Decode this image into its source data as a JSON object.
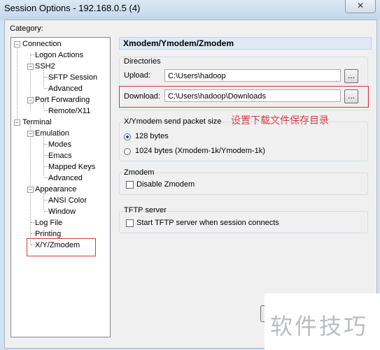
{
  "window": {
    "title": "Session Options - 192.168.0.5 (4)",
    "close_glyph": "✕"
  },
  "category": {
    "label": "Category:",
    "tree": [
      {
        "label": "Connection"
      },
      {
        "label": "Logon Actions"
      },
      {
        "label": "SSH2"
      },
      {
        "label": "SFTP Session"
      },
      {
        "label": "Advanced"
      },
      {
        "label": "Port Forwarding"
      },
      {
        "label": "Remote/X11"
      },
      {
        "label": "Terminal"
      },
      {
        "label": "Emulation"
      },
      {
        "label": "Modes"
      },
      {
        "label": "Emacs"
      },
      {
        "label": "Mapped Keys"
      },
      {
        "label": "Advanced"
      },
      {
        "label": "Appearance"
      },
      {
        "label": "ANSI Color"
      },
      {
        "label": "Window"
      },
      {
        "label": "Log File"
      },
      {
        "label": "Printing"
      },
      {
        "label": "X/Y/Zmodem"
      }
    ],
    "selected": "X/Y/Zmodem"
  },
  "panel": {
    "title": "Xmodem/Ymodem/Zmodem",
    "directories": {
      "label": "Directories",
      "upload_label": "Upload:",
      "upload_value": "C:\\Users\\hadoop",
      "download_label": "Download:",
      "download_value": "C:\\Users\\hadoop\\Downloads",
      "browse_label": "..."
    },
    "annotation": "设置下载文件保存目录",
    "packet": {
      "label": "X/Ymodem send packet size",
      "option1": "128 bytes",
      "option2": "1024 bytes  (Xmodem-1k/Ymodem-1k)",
      "selected": "128 bytes"
    },
    "zmodem": {
      "label": "Zmodem",
      "disable_label": "Disable Zmodem",
      "disable_checked": false
    },
    "tftp": {
      "label": "TFTP server",
      "start_label": "Start TFTP server when session connects",
      "start_checked": false
    }
  },
  "watermark": "软件技巧",
  "colors": {
    "annotation_red": "#d23a3a",
    "header_bg": "#dfe8f4",
    "window_frame": "#cfe0ef"
  }
}
